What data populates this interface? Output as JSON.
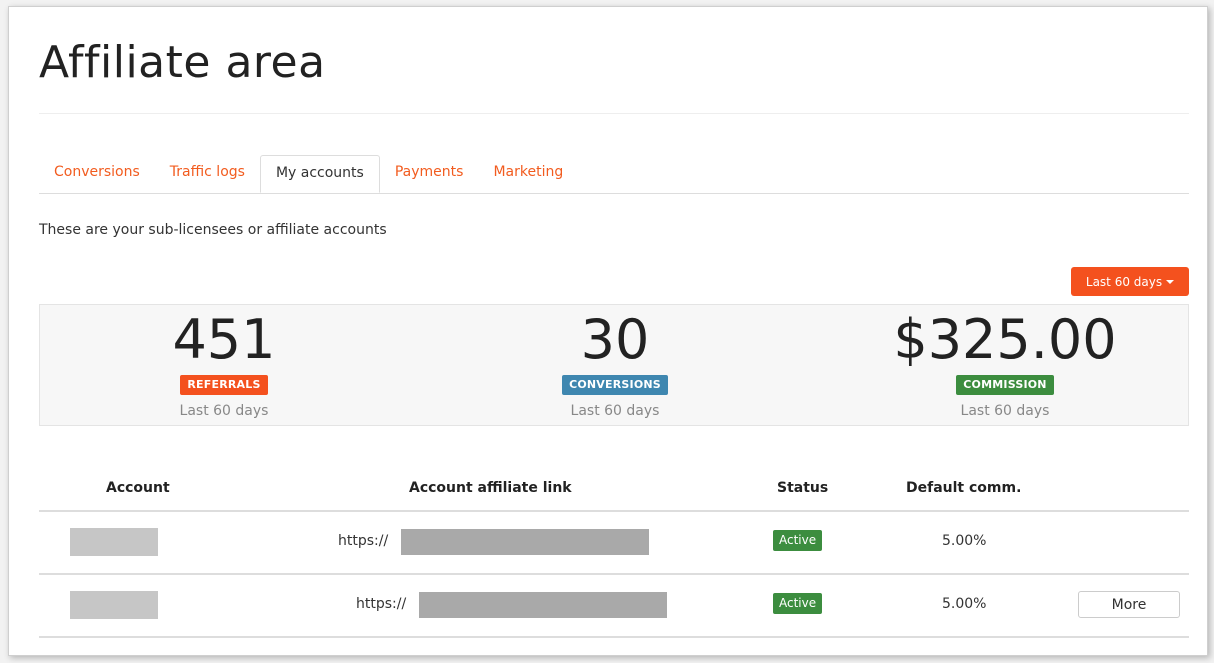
{
  "page": {
    "title": "Affiliate area"
  },
  "tabs": [
    {
      "label": "Conversions",
      "active": false
    },
    {
      "label": "Traffic logs",
      "active": false
    },
    {
      "label": "My accounts",
      "active": true
    },
    {
      "label": "Payments",
      "active": false
    },
    {
      "label": "Marketing",
      "active": false
    }
  ],
  "intro": "These are your sub-licensees or affiliate accounts",
  "range_button": {
    "label": "Last 60 days"
  },
  "stats": [
    {
      "value": "451",
      "badge": "REFERRALS",
      "badge_color": "#f4511e",
      "sub": "Last 60 days"
    },
    {
      "value": "30",
      "badge": "CONVERSIONS",
      "badge_color": "#3f87b0",
      "sub": "Last 60 days"
    },
    {
      "value": "$325.00",
      "badge": "COMMISSION",
      "badge_color": "#3c8d3f",
      "sub": "Last 60 days"
    }
  ],
  "table": {
    "headers": [
      "Account",
      "Account affiliate link",
      "Status",
      "Default comm."
    ],
    "rows": [
      {
        "link_prefix": "https://",
        "status": "Active",
        "commission": "5.00%",
        "action": ""
      },
      {
        "link_prefix": "https://",
        "status": "Active",
        "commission": "5.00%",
        "action": "More"
      }
    ]
  }
}
